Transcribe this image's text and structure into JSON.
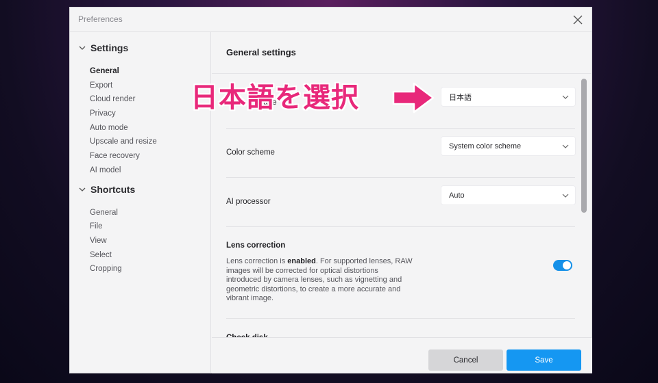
{
  "window": {
    "title": "Preferences",
    "close_icon": "close-icon"
  },
  "sidebar": {
    "sections": [
      {
        "label": "Settings",
        "items": [
          "General",
          "Export",
          "Cloud render",
          "Privacy",
          "Auto mode",
          "Upscale and resize",
          "Face recovery",
          "AI model"
        ],
        "active": "General"
      },
      {
        "label": "Shortcuts",
        "items": [
          "General",
          "File",
          "View",
          "Select",
          "Cropping"
        ]
      }
    ]
  },
  "main": {
    "title": "General settings",
    "language": {
      "label": "Language",
      "label_visible": "L",
      "label_tail": "age",
      "value": "日本語"
    },
    "color_scheme": {
      "label": "Color scheme",
      "value": "System color scheme"
    },
    "ai_processor": {
      "label": "AI processor",
      "value": "Auto"
    },
    "lens": {
      "title": "Lens correction",
      "desc_pre": "Lens correction is ",
      "desc_bold": "enabled",
      "desc_post": ". For supported lenses, RAW images will be corrected for optical distortions introduced by camera lenses, such as vignetting and geometric distortions, to create a more accurate and vibrant image.",
      "enabled": true
    },
    "next_section_cutoff": "Check disk"
  },
  "footer": {
    "cancel_label": "Cancel",
    "save_label": "Save"
  },
  "annotation": {
    "text": "日本語を選択",
    "color": "#e8287a",
    "arrow_icon": "right-arrow-icon"
  },
  "colors": {
    "accent": "#1597f2",
    "toggle_on": "#1590e8"
  }
}
